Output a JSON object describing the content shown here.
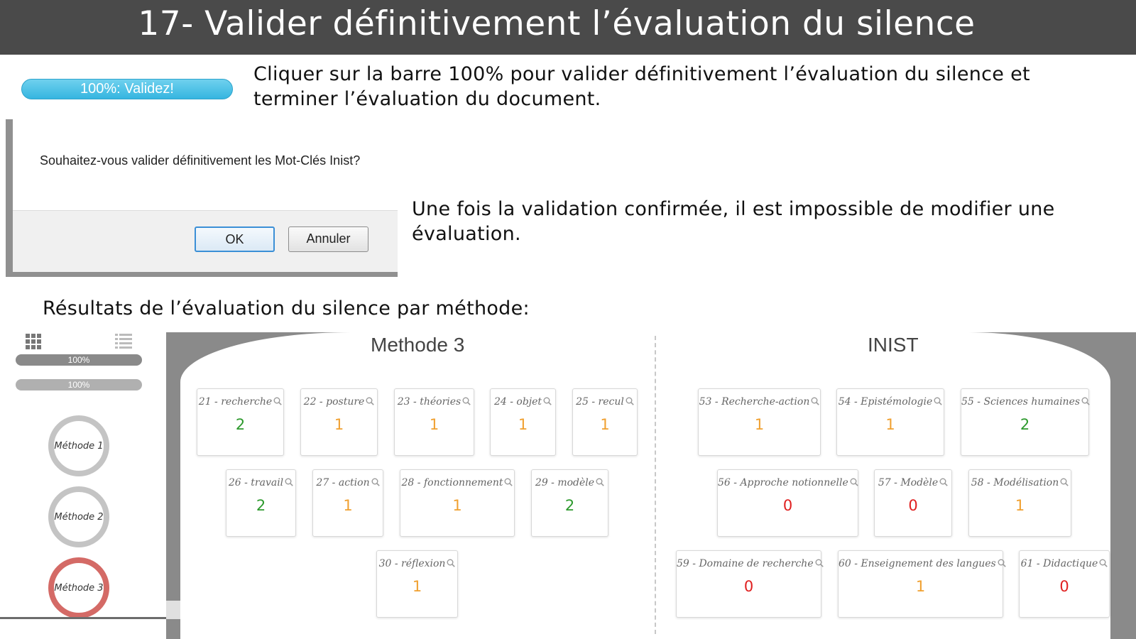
{
  "title": "17- Valider définitivement l’évaluation du silence",
  "validez_bar": {
    "label": "100%: Validez!",
    "progress_percent": 100,
    "color": "#35b5e0"
  },
  "instructions": {
    "line1a": "Cliquer sur la barre 100% pour valider définitivement l’évaluation du silence et",
    "line1b": "terminer l’évaluation du document.",
    "line2a": "Une fois la validation confirmée, il est impossible de modifier une",
    "line2b": "évaluation."
  },
  "dialog": {
    "message": "Souhaitez-vous valider définitivement les Mot-Clés Inist?",
    "ok_label": "OK",
    "cancel_label": "Annuler"
  },
  "results_heading": "Résultats de l’évaluation du silence par méthode:",
  "sidebar": {
    "view_icons": [
      "grid-icon",
      "list-icon"
    ],
    "progress_bars": [
      {
        "label": "100%",
        "progress_percent": 100
      },
      {
        "label": "100%",
        "progress_percent": 100
      }
    ],
    "methods": [
      {
        "label": "Méthode 1",
        "active": false
      },
      {
        "label": "Méthode 2",
        "active": false
      },
      {
        "label": "Méthode 3",
        "active": true
      }
    ],
    "active_color": "#d46a66"
  },
  "value_colors": {
    "0": "#e02020",
    "1": "#f0a030",
    "2": "#2e9a2e"
  },
  "methode3": {
    "title": "Methode 3",
    "keywords": [
      {
        "label": "21 - recherche",
        "value": "2"
      },
      {
        "label": "22 - posture",
        "value": "1"
      },
      {
        "label": "23 - théories",
        "value": "1"
      },
      {
        "label": "24 - objet",
        "value": "1"
      },
      {
        "label": "25 - recul",
        "value": "1"
      },
      {
        "label": "26 - travail",
        "value": "2"
      },
      {
        "label": "27 - action",
        "value": "1"
      },
      {
        "label": "28 - fonctionnement",
        "value": "1"
      },
      {
        "label": "29 - modèle",
        "value": "2"
      },
      {
        "label": "30 - réflexion",
        "value": "1"
      }
    ]
  },
  "inist": {
    "title": "INIST",
    "keywords": [
      {
        "label": "53 - Recherche-action",
        "value": "1"
      },
      {
        "label": "54 - Epistémologie",
        "value": "1"
      },
      {
        "label": "55 - Sciences humaines",
        "value": "2"
      },
      {
        "label": "56 - Approche notionnelle",
        "value": "0"
      },
      {
        "label": "57 - Modèle",
        "value": "0"
      },
      {
        "label": "58 - Modélisation",
        "value": "1"
      },
      {
        "label": "59 - Domaine de recherche",
        "value": "0"
      },
      {
        "label": "60 - Enseignement des langues",
        "value": "1"
      },
      {
        "label": "61 - Didactique",
        "value": "0"
      }
    ]
  }
}
